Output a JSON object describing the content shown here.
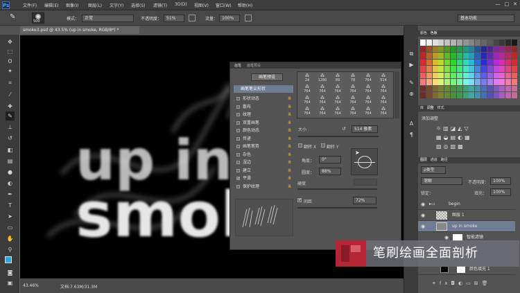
{
  "menubar": {
    "logo": "Ps",
    "items": [
      "文件(F)",
      "编辑(E)",
      "图像(I)",
      "图层(L)",
      "文字(Y)",
      "选择(S)",
      "滤镜(T)",
      "3D(D)",
      "视图(V)",
      "窗口(W)",
      "帮助(H)"
    ],
    "window_controls": [
      "—",
      "□",
      "✕"
    ]
  },
  "options": {
    "brush_size": "500",
    "mode_label": "模式：",
    "mode_value": "正常",
    "opacity_label": "不透明度：",
    "opacity_value": "51%",
    "flow_label": "流量：",
    "flow_value": "100%",
    "workspace": "基本功能"
  },
  "document": {
    "tab_title": "smoke3.psd @ 43.5% (up in smoke, RGB/8*) *",
    "close": "×"
  },
  "canvas": {
    "text_line1": "up in",
    "text_line2": "smoke"
  },
  "status": {
    "zoom": "43.46%",
    "doc_info": "文档:7.63M/31.3M"
  },
  "brush_panel": {
    "tabs": [
      "画笔",
      "画笔预设"
    ],
    "preset_button": "画笔预设",
    "tip_shape": "画笔笔尖形状",
    "categories": [
      {
        "label": "形状动态",
        "checked": false
      },
      {
        "label": "散布",
        "checked": false
      },
      {
        "label": "纹理",
        "checked": false
      },
      {
        "label": "双重画笔",
        "checked": false
      },
      {
        "label": "颜色动态",
        "checked": false
      },
      {
        "label": "传递",
        "checked": false
      },
      {
        "label": "画笔笔势",
        "checked": false
      },
      {
        "label": "杂色",
        "checked": false
      },
      {
        "label": "湿边",
        "checked": false
      },
      {
        "label": "建立",
        "checked": false
      },
      {
        "label": "平滑",
        "checked": true
      },
      {
        "label": "保护纹理",
        "checked": false
      }
    ],
    "tip_sizes_row1": [
      "24",
      "1280",
      "89",
      "78",
      "764",
      "514"
    ],
    "tip_sizes_row2": [
      "764",
      "764",
      "764",
      "764",
      "764",
      "764"
    ],
    "tip_sizes_row3": [
      "764",
      "764",
      "764",
      "764",
      "764",
      "764"
    ],
    "tip_sizes_row4": [
      "764",
      "764",
      "764",
      "764",
      "764",
      "764"
    ],
    "size_label": "大小",
    "size_value": "514 像素",
    "flip_x": "翻转 X",
    "flip_y": "翻转 Y",
    "angle_label": "角度：",
    "angle_value": "0°",
    "roundness_label": "圆度：",
    "roundness_value": "88%",
    "hardness_label": "硬度",
    "spacing_label": "间距",
    "spacing_value": "72%"
  },
  "swatches": {
    "tabs": [
      "颜色",
      "色板"
    ]
  },
  "adjustments": {
    "tabs": [
      "库",
      "调整",
      "样式"
    ],
    "title": "添加调整"
  },
  "layers": {
    "tabs": [
      "图层",
      "通道",
      "路径"
    ],
    "kind": "ρ类型",
    "blend": "溶解",
    "opacity_label": "不透明度：",
    "opacity_value": "100%",
    "lock_label": "锁定：",
    "fill_label": "填充：",
    "fill_value": "100%",
    "items": [
      {
        "name": "begin",
        "type": "group"
      },
      {
        "name": "图层 1",
        "type": "layer"
      },
      {
        "name": "up in smoke",
        "type": "smart"
      },
      {
        "name": "智能滤镜",
        "type": "filter"
      },
      {
        "name": "颜色填充 1",
        "type": "fill"
      }
    ]
  },
  "watermark": {
    "text": "笔刷绘画全面剖析"
  },
  "colors": {
    "accent": "#b42536",
    "bg": "#535353"
  }
}
